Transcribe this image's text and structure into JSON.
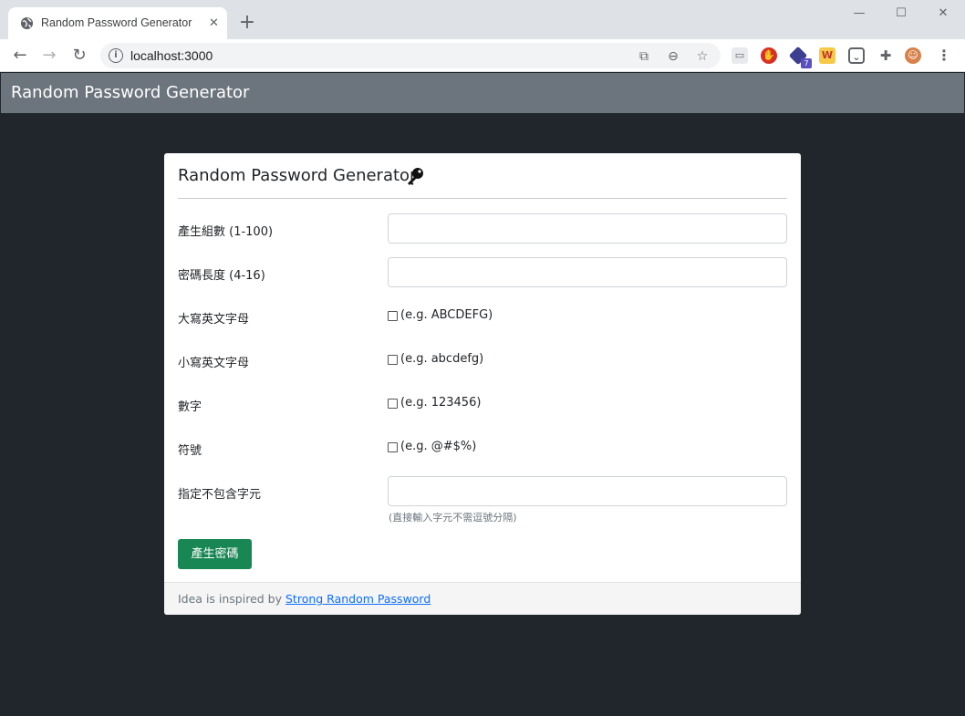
{
  "browser": {
    "tab_title": "Random Password Generator",
    "new_tab_symbol": "+",
    "url": "localhost:3000",
    "extension_badge": "7"
  },
  "app": {
    "navbar_title": "Random Password Generator"
  },
  "card": {
    "title": "Random Password Generator",
    "fields": {
      "count_label": "產生組數 (1-100)",
      "length_label": "密碼長度 (4-16)",
      "uppercase_label": "大寫英文字母",
      "uppercase_example": "(e.g. ABCDEFG)",
      "lowercase_label": "小寫英文字母",
      "lowercase_example": "(e.g. abcdefg)",
      "numbers_label": "數字",
      "numbers_example": "(e.g. 123456)",
      "symbols_label": "符號",
      "symbols_example": "(e.g. @#$%)",
      "exclude_label": "指定不包含字元",
      "exclude_help": "(直接輸入字元不需逗號分隔)"
    },
    "submit_label": "產生密碼",
    "footer": {
      "prefix": "Idea is inspired by",
      "link_text": "Strong Random Password"
    }
  },
  "colors": {
    "page_background": "#21252c",
    "navbar": "#6c757d",
    "submit_button": "#198754",
    "link": "#0d6efd"
  }
}
